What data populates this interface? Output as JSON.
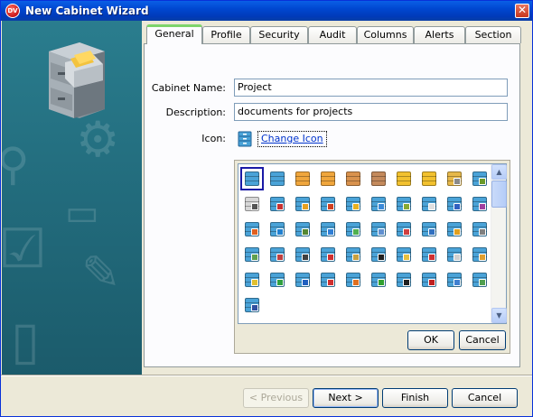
{
  "window": {
    "title": "New Cabinet Wizard",
    "logo_text": "DV",
    "close_glyph": "✕"
  },
  "colors": {
    "sidebar": "#226b7c",
    "tab_active_accent": "#7dd46b",
    "title_bar": "#0047d0",
    "link": "#0033cc"
  },
  "tabs": [
    {
      "label": "General",
      "active": true
    },
    {
      "label": "Profile",
      "active": false
    },
    {
      "label": "Security",
      "active": false
    },
    {
      "label": "Audit",
      "active": false
    },
    {
      "label": "Columns",
      "active": false
    },
    {
      "label": "Alerts",
      "active": false
    },
    {
      "label": "Section",
      "active": false
    }
  ],
  "form": {
    "cabinet_name_label": "Cabinet Name:",
    "cabinet_name_value": "Project",
    "description_label": "Description:",
    "description_value": "documents for projects",
    "icon_label": "Icon:",
    "change_icon_link": "Change Icon"
  },
  "icon_picker": {
    "icons": [
      {
        "base": "#4aa3d8",
        "mini": ""
      },
      {
        "base": "#4aa3d8",
        "mini": ""
      },
      {
        "base": "#f0a63c",
        "mini": ""
      },
      {
        "base": "#f0a63c",
        "mini": ""
      },
      {
        "base": "#d9924d",
        "mini": ""
      },
      {
        "base": "#c48a5c",
        "mini": ""
      },
      {
        "base": "#f2c12e",
        "mini": ""
      },
      {
        "base": "#f2c12e",
        "mini": ""
      },
      {
        "base": "#e6b84a",
        "mini": "#8a8a8a"
      },
      {
        "base": "#4aa3d8",
        "mini": "#6a9a2a"
      },
      {
        "base": "#d7d7d7",
        "mini": "#555555"
      },
      {
        "base": "#4aa3d8",
        "mini": "#c83232"
      },
      {
        "base": "#4aa3d8",
        "mini": "#e6a020"
      },
      {
        "base": "#4aa3d8",
        "mini": "#d04020"
      },
      {
        "base": "#4aa3d8",
        "mini": "#e8b020"
      },
      {
        "base": "#4aa3d8",
        "mini": "#3a8ad8"
      },
      {
        "base": "#4aa3d8",
        "mini": "#88aa33"
      },
      {
        "base": "#4aa3d8",
        "mini": "#e0e0e0"
      },
      {
        "base": "#4aa3d8",
        "mini": "#3060c0"
      },
      {
        "base": "#4aa3d8",
        "mini": "#a040a0"
      },
      {
        "base": "#4aa3d8",
        "mini": "#e06020"
      },
      {
        "base": "#4aa3d8",
        "mini": "#2080d0"
      },
      {
        "base": "#4aa3d8",
        "mini": "#558833"
      },
      {
        "base": "#4aa3d8",
        "mini": "#2f7fd6"
      },
      {
        "base": "#4aa3d8",
        "mini": "#50b050"
      },
      {
        "base": "#4aa3d8",
        "mini": "#6090d0"
      },
      {
        "base": "#4aa3d8",
        "mini": "#d04040"
      },
      {
        "base": "#4aa3d8",
        "mini": "#3070c0"
      },
      {
        "base": "#4aa3d8",
        "mini": "#e0a020"
      },
      {
        "base": "#4aa3d8",
        "mini": "#808080"
      },
      {
        "base": "#4aa3d8",
        "mini": "#5fa04f"
      },
      {
        "base": "#4aa3d8",
        "mini": "#c04040"
      },
      {
        "base": "#4aa3d8",
        "mini": "#404040"
      },
      {
        "base": "#4aa3d8",
        "mini": "#d03030"
      },
      {
        "base": "#4aa3d8",
        "mini": "#c8a040"
      },
      {
        "base": "#4aa3d8",
        "mini": "#202020"
      },
      {
        "base": "#4aa3d8",
        "mini": "#e8c040"
      },
      {
        "base": "#4aa3d8",
        "mini": "#d03030"
      },
      {
        "base": "#4aa3d8",
        "mini": "#d0d0d0"
      },
      {
        "base": "#4aa3d8",
        "mini": "#e0a030"
      },
      {
        "base": "#4aa3d8",
        "mini": "#e0c030"
      },
      {
        "base": "#4aa3d8",
        "mini": "#30a040"
      },
      {
        "base": "#4aa3d8",
        "mini": "#2060c0"
      },
      {
        "base": "#4aa3d8",
        "mini": "#d03030"
      },
      {
        "base": "#4aa3d8",
        "mini": "#e07020"
      },
      {
        "base": "#4aa3d8",
        "mini": "#30a030"
      },
      {
        "base": "#4aa3d8",
        "mini": "#202020"
      },
      {
        "base": "#4aa3d8",
        "mini": "#c02020"
      },
      {
        "base": "#4aa3d8",
        "mini": "#4080d0"
      },
      {
        "base": "#4aa3d8",
        "mini": "#50a050"
      },
      {
        "base": "#4aa3d8",
        "mini": "#3050a0"
      }
    ],
    "scroll_up_glyph": "▲",
    "scroll_down_glyph": "▼",
    "ok_label": "OK",
    "cancel_label": "Cancel"
  },
  "footer": {
    "previous_label": "< Previous",
    "next_label": "Next >",
    "finish_label": "Finish",
    "cancel_label": "Cancel"
  }
}
